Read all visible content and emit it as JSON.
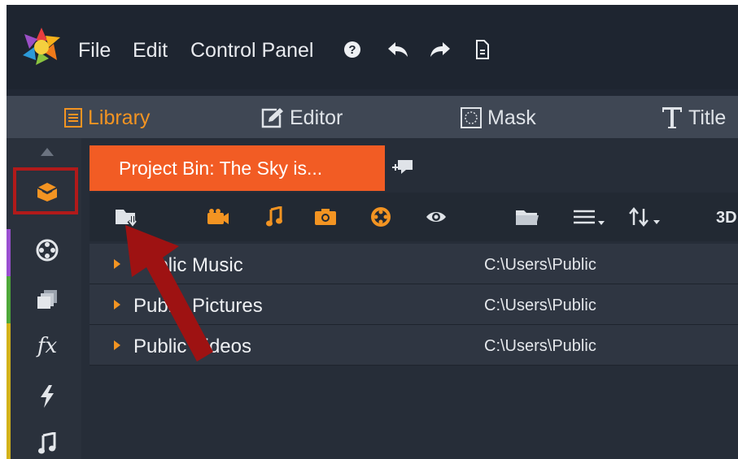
{
  "menu": {
    "items": [
      "File",
      "Edit",
      "Control Panel"
    ],
    "icons": [
      "help-icon",
      "undo-icon",
      "redo-icon",
      "document-icon"
    ]
  },
  "modes": [
    {
      "label": "Library",
      "icon": "list-icon",
      "active": true
    },
    {
      "label": "Editor",
      "icon": "edit-icon",
      "active": false
    },
    {
      "label": "Mask",
      "icon": "mask-icon",
      "active": false
    },
    {
      "label": "Title",
      "icon": "title-icon",
      "active": false
    }
  ],
  "sidebar": {
    "items": [
      "project-bin-icon",
      "media-reel-icon",
      "collections-icon",
      "effects-icon",
      "transitions-icon",
      "music-icon"
    ],
    "effects_glyph": "fx"
  },
  "bin": {
    "tab_label": "Project Bin: The Sky is...",
    "toolbar_3d": "3D"
  },
  "folders": [
    {
      "name": "Public Music",
      "path": "C:\\Users\\Public"
    },
    {
      "name": "Public Pictures",
      "path": "C:\\Users\\Public"
    },
    {
      "name": "Public Videos",
      "path": "C:\\Users\\Public"
    }
  ],
  "colors": {
    "accent": "#f39422",
    "bin_tab": "#f25c24",
    "annotation": "#b11a1a"
  }
}
